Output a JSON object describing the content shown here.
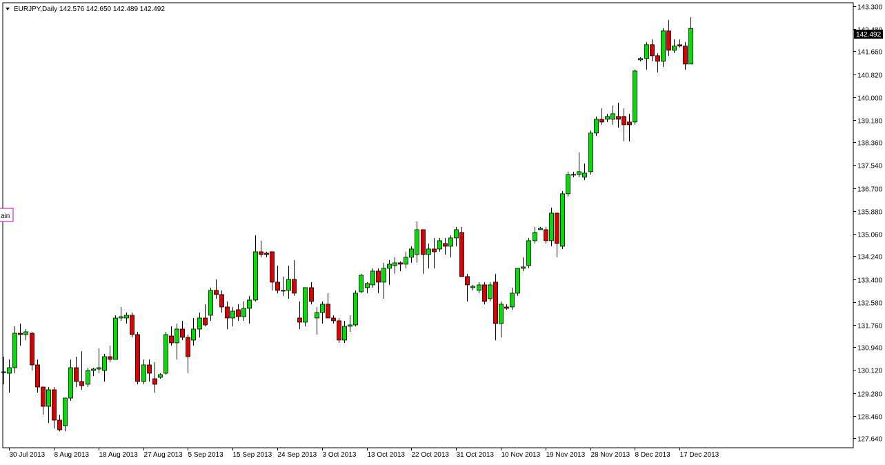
{
  "header": {
    "symbol": "EURJPY,Daily",
    "ohlc": "142.576 142.650 142.489 142.492"
  },
  "price_marker": "142.492",
  "side_label": "ain",
  "colors": {
    "bull": "#00e000",
    "bear": "#dd0000",
    "outline": "#000000",
    "axis": "#000000",
    "background": "#ffffff",
    "marker_bg": "#000000",
    "marker_text": "#ffffff",
    "side_label_border": "#c000c0"
  },
  "chart_data": {
    "type": "candlestick",
    "ylim": [
      127.3,
      143.42
    ],
    "y_ticks": [
      "143.300",
      "142.480",
      "141.660",
      "140.820",
      "140.000",
      "139.180",
      "138.360",
      "137.540",
      "136.700",
      "135.880",
      "135.060",
      "134.240",
      "133.400",
      "132.580",
      "131.760",
      "130.940",
      "130.120",
      "129.280",
      "128.460",
      "127.640"
    ],
    "x_ticks": [
      {
        "label": "30 Jul 2013",
        "index": 1
      },
      {
        "label": "8 Aug 2013",
        "index": 9
      },
      {
        "label": "18 Aug 2013",
        "index": 17
      },
      {
        "label": "27 Aug 2013",
        "index": 25
      },
      {
        "label": "5 Sep 2013",
        "index": 33
      },
      {
        "label": "15 Sep 2013",
        "index": 41
      },
      {
        "label": "24 Sep 2013",
        "index": 49
      },
      {
        "label": "3 Oct 2013",
        "index": 57
      },
      {
        "label": "13 Oct 2013",
        "index": 65
      },
      {
        "label": "22 Oct 2013",
        "index": 73
      },
      {
        "label": "31 Oct 2013",
        "index": 81
      },
      {
        "label": "10 Nov 2013",
        "index": 89
      },
      {
        "label": "19 Nov 2013",
        "index": 97
      },
      {
        "label": "28 Nov 2013",
        "index": 105
      },
      {
        "label": "8 Dec 2013",
        "index": 113
      },
      {
        "label": "17 Dec 2013",
        "index": 121
      }
    ],
    "candles": [
      [
        130.05,
        130.6,
        129.6,
        130.05
      ],
      [
        130.0,
        130.5,
        129.3,
        130.2
      ],
      [
        130.2,
        131.7,
        130.0,
        131.45
      ],
      [
        131.45,
        131.8,
        131.0,
        131.4
      ],
      [
        131.4,
        131.6,
        131.2,
        131.5
      ],
      [
        131.45,
        131.5,
        130.1,
        130.3
      ],
      [
        130.3,
        130.5,
        129.3,
        129.5
      ],
      [
        129.5,
        129.5,
        128.5,
        128.8
      ],
      [
        128.8,
        129.5,
        128.2,
        129.4
      ],
      [
        129.4,
        129.5,
        128.0,
        128.3
      ],
      [
        128.3,
        128.5,
        127.9,
        127.95
      ],
      [
        128.1,
        129.1,
        127.9,
        129.1
      ],
      [
        129.1,
        130.5,
        129.0,
        130.2
      ],
      [
        130.2,
        130.6,
        129.5,
        129.7
      ],
      [
        129.7,
        130.8,
        129.4,
        129.55
      ],
      [
        129.6,
        130.2,
        129.5,
        130.1
      ],
      [
        130.1,
        130.2,
        129.9,
        130.15
      ],
      [
        130.15,
        130.9,
        130.0,
        130.2
      ],
      [
        130.1,
        130.7,
        129.7,
        130.6
      ],
      [
        130.6,
        131.0,
        130.4,
        130.5
      ],
      [
        130.5,
        132.1,
        130.5,
        132.0
      ],
      [
        132.0,
        132.4,
        131.9,
        132.05
      ],
      [
        132.0,
        132.2,
        131.8,
        132.1
      ],
      [
        132.1,
        132.2,
        131.3,
        131.4
      ],
      [
        131.4,
        131.5,
        129.6,
        129.7
      ],
      [
        129.7,
        130.5,
        129.6,
        130.3
      ],
      [
        130.3,
        130.5,
        129.7,
        130.0
      ],
      [
        129.8,
        130.4,
        129.3,
        129.6
      ],
      [
        129.85,
        130.0,
        129.8,
        129.95
      ],
      [
        130.0,
        131.5,
        129.95,
        131.4
      ],
      [
        131.35,
        131.7,
        131.0,
        131.1
      ],
      [
        131.1,
        131.8,
        130.5,
        131.6
      ],
      [
        131.6,
        131.9,
        131.2,
        131.3
      ],
      [
        131.3,
        131.4,
        130.0,
        130.6
      ],
      [
        131.2,
        132.0,
        131.0,
        131.6
      ],
      [
        131.6,
        132.2,
        131.3,
        132.0
      ],
      [
        132.0,
        132.5,
        131.7,
        131.75
      ],
      [
        132.1,
        133.1,
        131.9,
        133.0
      ],
      [
        133.0,
        133.4,
        132.7,
        132.85
      ],
      [
        132.85,
        133.0,
        132.2,
        132.4
      ],
      [
        132.4,
        132.6,
        131.6,
        132.0
      ],
      [
        132.0,
        132.4,
        131.7,
        132.25
      ],
      [
        132.3,
        132.5,
        131.9,
        132.05
      ],
      [
        132.05,
        132.6,
        131.9,
        132.35
      ],
      [
        132.35,
        132.8,
        131.8,
        132.65
      ],
      [
        132.65,
        135.0,
        132.6,
        134.4
      ],
      [
        134.4,
        134.8,
        134.2,
        134.3
      ],
      [
        134.35,
        134.4,
        134.2,
        134.3
      ],
      [
        134.4,
        134.4,
        133.0,
        133.3
      ],
      [
        133.3,
        133.9,
        132.9,
        133.0
      ],
      [
        133.0,
        133.5,
        132.8,
        133.0
      ],
      [
        133.0,
        133.9,
        132.7,
        133.4
      ],
      [
        133.4,
        134.1,
        132.8,
        132.9
      ],
      [
        132.0,
        132.6,
        131.6,
        131.85
      ],
      [
        131.85,
        133.1,
        131.7,
        133.1
      ],
      [
        133.1,
        133.3,
        132.5,
        132.6
      ],
      [
        132.0,
        132.4,
        131.4,
        132.2
      ],
      [
        132.2,
        132.6,
        131.8,
        132.5
      ],
      [
        132.5,
        132.9,
        132.0,
        132.0
      ],
      [
        132.0,
        132.1,
        131.8,
        131.9
      ],
      [
        131.9,
        132.0,
        131.1,
        131.2
      ],
      [
        131.2,
        131.9,
        131.1,
        131.7
      ],
      [
        131.7,
        132.1,
        131.5,
        131.75
      ],
      [
        131.75,
        133.0,
        131.7,
        132.9
      ],
      [
        132.95,
        133.6,
        132.9,
        133.55
      ],
      [
        133.1,
        133.3,
        132.9,
        133.25
      ],
      [
        133.2,
        133.8,
        133.1,
        133.7
      ],
      [
        133.7,
        133.8,
        132.9,
        133.3
      ],
      [
        133.3,
        134.0,
        132.7,
        133.8
      ],
      [
        133.8,
        134.1,
        133.2,
        133.95
      ],
      [
        133.9,
        134.2,
        133.6,
        134.0
      ],
      [
        134.0,
        134.05,
        133.7,
        133.95
      ],
      [
        133.95,
        134.4,
        133.8,
        134.2
      ],
      [
        134.2,
        134.6,
        134.0,
        134.5
      ],
      [
        134.3,
        135.5,
        134.0,
        135.2
      ],
      [
        135.2,
        135.2,
        133.6,
        134.3
      ],
      [
        134.3,
        134.7,
        133.8,
        134.5
      ],
      [
        134.5,
        134.9,
        133.8,
        134.4
      ],
      [
        134.5,
        134.9,
        134.4,
        134.8
      ],
      [
        134.7,
        134.9,
        134.3,
        134.6
      ],
      [
        134.6,
        135.0,
        134.2,
        134.9
      ],
      [
        134.9,
        135.3,
        134.6,
        135.2
      ],
      [
        135.1,
        135.3,
        133.5,
        133.5
      ],
      [
        133.5,
        133.6,
        132.6,
        133.2
      ],
      [
        133.1,
        133.2,
        133.0,
        133.15
      ],
      [
        133.0,
        133.3,
        132.9,
        133.2
      ],
      [
        133.2,
        133.3,
        132.5,
        132.6
      ],
      [
        132.7,
        133.3,
        132.6,
        133.2
      ],
      [
        133.3,
        133.6,
        131.2,
        131.8
      ],
      [
        131.8,
        132.6,
        131.3,
        132.5
      ],
      [
        132.4,
        132.5,
        132.3,
        132.35
      ],
      [
        132.4,
        133.1,
        132.3,
        132.9
      ],
      [
        132.9,
        133.8,
        132.8,
        133.8
      ],
      [
        133.8,
        134.2,
        133.7,
        133.85
      ],
      [
        133.9,
        134.9,
        133.8,
        134.8
      ],
      [
        134.8,
        135.3,
        134.7,
        135.1
      ],
      [
        135.2,
        135.3,
        135.2,
        135.25
      ],
      [
        135.2,
        135.3,
        134.7,
        134.8
      ],
      [
        134.8,
        136.0,
        134.6,
        135.8
      ],
      [
        135.8,
        135.8,
        134.2,
        134.7
      ],
      [
        134.6,
        136.6,
        134.5,
        136.5
      ],
      [
        136.5,
        137.3,
        136.4,
        137.2
      ],
      [
        137.2,
        137.3,
        137.1,
        137.2
      ],
      [
        137.2,
        138.0,
        137.1,
        137.3
      ],
      [
        137.1,
        137.6,
        137.0,
        137.25
      ],
      [
        137.3,
        138.8,
        137.2,
        138.7
      ],
      [
        138.7,
        139.3,
        138.6,
        139.2
      ],
      [
        139.2,
        139.6,
        139.0,
        139.1
      ],
      [
        139.2,
        139.4,
        139.1,
        139.3
      ],
      [
        139.2,
        139.7,
        139.0,
        139.4
      ],
      [
        139.3,
        139.8,
        138.9,
        139.2
      ],
      [
        139.3,
        139.6,
        138.4,
        139.0
      ],
      [
        139.1,
        139.4,
        138.4,
        139.0
      ],
      [
        139.1,
        141.0,
        139.0,
        140.95
      ],
      [
        141.35,
        141.45,
        141.3,
        141.4
      ],
      [
        141.4,
        142.0,
        141.0,
        141.9
      ],
      [
        141.9,
        142.1,
        141.3,
        141.5
      ],
      [
        141.5,
        141.6,
        140.9,
        141.3
      ],
      [
        141.3,
        142.5,
        141.1,
        142.4
      ],
      [
        142.4,
        142.8,
        141.5,
        141.7
      ],
      [
        141.7,
        142.1,
        141.6,
        141.85
      ],
      [
        141.9,
        142.1,
        141.8,
        141.85
      ],
      [
        141.85,
        142.0,
        141.0,
        141.2
      ],
      [
        141.2,
        142.9,
        141.2,
        142.49
      ]
    ]
  }
}
